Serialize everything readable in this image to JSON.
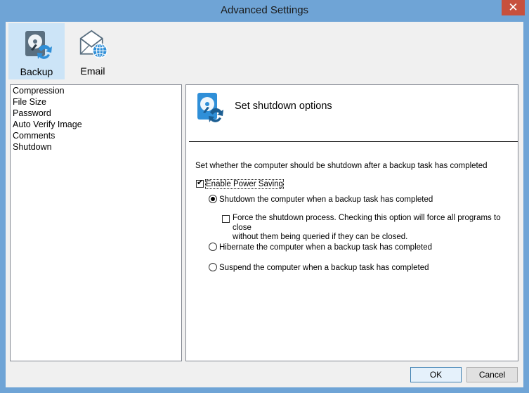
{
  "window": {
    "title": "Advanced Settings",
    "close_glyph": "✕"
  },
  "toolbar": {
    "items": [
      {
        "label": "Backup",
        "icon": "backup-disk-icon",
        "selected": true
      },
      {
        "label": "Email",
        "icon": "email-globe-icon",
        "selected": false
      }
    ]
  },
  "nav": {
    "items": [
      {
        "label": "Compression"
      },
      {
        "label": "File Size"
      },
      {
        "label": "Password"
      },
      {
        "label": "Auto Verify Image"
      },
      {
        "label": "Comments"
      },
      {
        "label": "Shutdown",
        "selected": true
      }
    ]
  },
  "panel": {
    "title": "Set shutdown options",
    "description": "Set whether the computer should be shutdown after a backup task has completed",
    "enable_power_saving": {
      "label": "Enable Power Saving",
      "checked": true
    },
    "shutdown_option": {
      "label": "Shutdown the computer when a backup task has completed",
      "selected": true
    },
    "force_shutdown": {
      "line1": "Force the shutdown process.  Checking this option will force all programs to close",
      "line2": "without them being queried if they can be closed.",
      "checked": false
    },
    "hibernate_option": {
      "label": "Hibernate the computer when a backup task has completed",
      "selected": false
    },
    "suspend_option": {
      "label": "Suspend the computer when a backup task has completed",
      "selected": false
    }
  },
  "buttons": {
    "ok": "OK",
    "cancel": "Cancel"
  },
  "colors": {
    "accent": "#6fa4d6",
    "selection": "#cce4f7",
    "close": "#c7503d"
  }
}
